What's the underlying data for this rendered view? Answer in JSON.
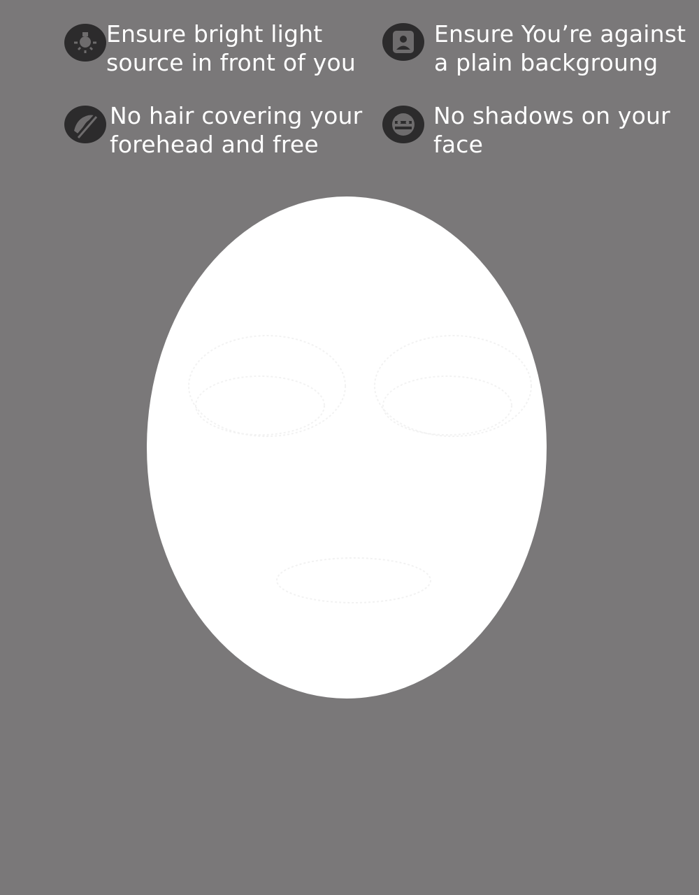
{
  "tips": [
    {
      "icon": "light-bulb-icon",
      "lines": [
        "Ensure bright light",
        "source in front of you"
      ]
    },
    {
      "icon": "person-portrait-icon",
      "lines": [
        "Ensure You’re against",
        "a plain backgroung"
      ]
    },
    {
      "icon": "hair-off-icon",
      "lines": [
        "No hair covering your",
        "forehead and free"
      ]
    },
    {
      "icon": "face-shadow-icon",
      "lines": [
        "No shadows on your",
        "face"
      ]
    }
  ],
  "colors": {
    "background": "#7a7879",
    "icon_circle": "#2c2b2c",
    "icon_glyph": "#6e6c6d",
    "face_oval": "#ffffff",
    "text": "#ffffff"
  }
}
